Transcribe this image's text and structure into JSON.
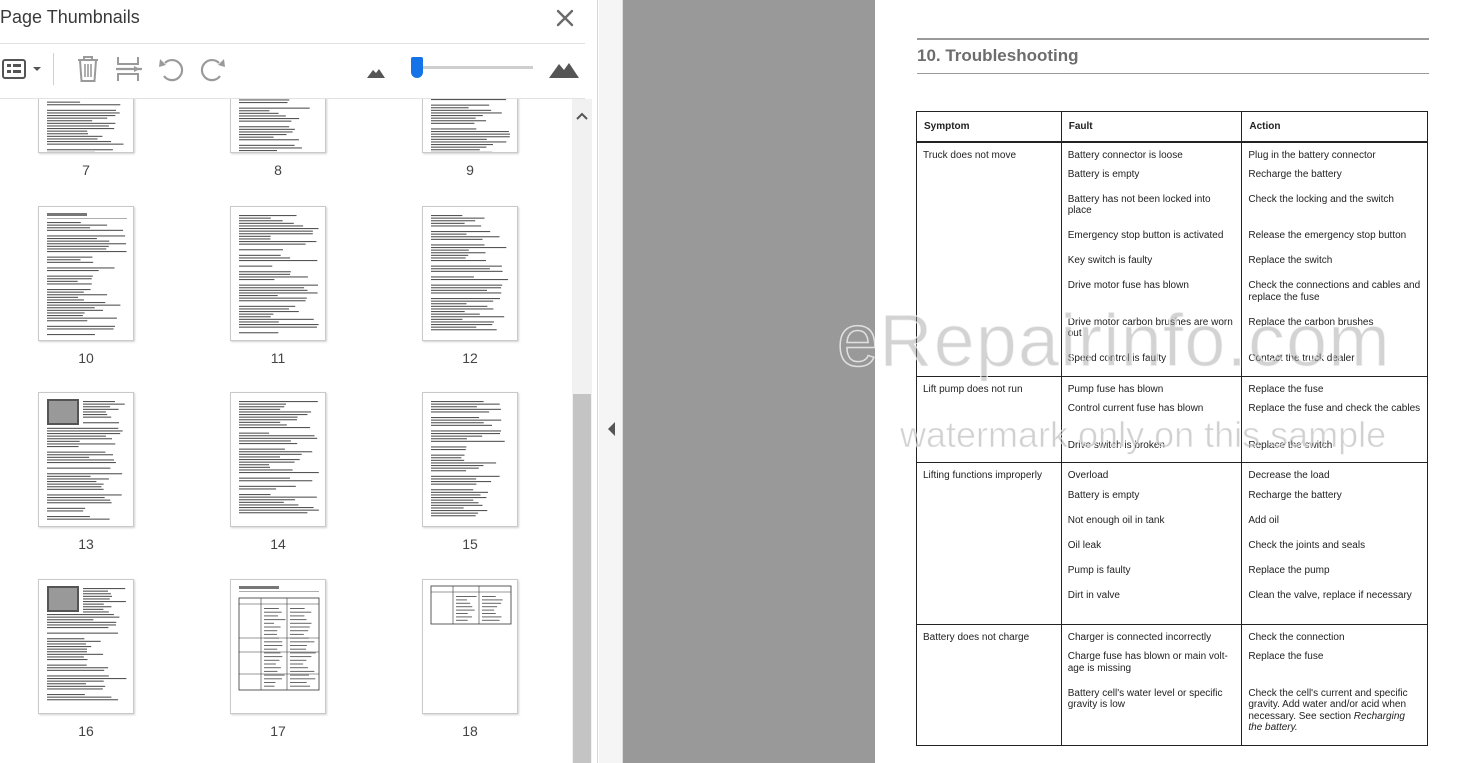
{
  "panel": {
    "title": "Page Thumbnails",
    "close_icon": "close-icon",
    "toolbar": {
      "options_icon": "thumbnail-options-icon",
      "delete_icon": "trash-icon",
      "insert_icon": "insert-page-icon",
      "undo_icon": "rotate-counterclockwise-icon",
      "redo_icon": "rotate-clockwise-icon",
      "zoom_out_icon": "small-mountain-icon",
      "zoom_in_icon": "large-mountain-icon",
      "zoom_level": 0.05
    },
    "accent": "#1473e6",
    "thumbnails": [
      "7",
      "8",
      "9",
      "10",
      "11",
      "12",
      "13",
      "14",
      "15",
      "16",
      "17",
      "18"
    ]
  },
  "document": {
    "heading": "10.  Troubleshooting",
    "table": {
      "headers": [
        "Symptom",
        "Fault",
        "Action"
      ],
      "groups": [
        {
          "symptom": "Truck does not move",
          "rows": [
            [
              "Battery connector is loose",
              "Plug in the battery connector"
            ],
            [
              "Battery is empty",
              "Recharge the battery"
            ],
            [
              "Battery has not been locked into place",
              "Check the locking and the switch"
            ],
            [
              "Emergency stop button is activated",
              "Release the emergency stop button"
            ],
            [
              "Key switch is faulty",
              "Replace the switch"
            ],
            [
              "Drive motor fuse has blown",
              "Check the connections and cables and replace the fuse"
            ],
            [
              "Drive motor carbon brushes are worn out",
              "Replace the carbon brushes"
            ],
            [
              "Speed control is faulty",
              "Contact the truck dealer"
            ]
          ]
        },
        {
          "symptom": "Lift pump does not run",
          "rows": [
            [
              "Pump fuse has blown",
              "Replace the fuse"
            ],
            [
              "Control current fuse has blown",
              "Replace the fuse and check the cables"
            ],
            [
              "Drive switch is broken",
              "Replace the switch"
            ]
          ]
        },
        {
          "symptom": "Lifting functions improperly",
          "rows": [
            [
              "Overload",
              "Decrease the load"
            ],
            [
              "Battery is empty",
              "Recharge the battery"
            ],
            [
              "Not enough oil in tank",
              "Add oil"
            ],
            [
              "Oil leak",
              "Check the joints and seals"
            ],
            [
              "Pump is faulty",
              "Replace the pump"
            ],
            [
              "Dirt in valve",
              "Clean the valve, replace if necessary"
            ]
          ]
        },
        {
          "symptom": "Battery does not charge",
          "rows": [
            [
              "Charger is connected incorrectly",
              "Check the connection"
            ],
            [
              "Charge fuse has blown or main volt-age is missing",
              "Replace the fuse"
            ],
            [
              "Battery cell's water level or specific gravity is low",
              "Check the cell's current and specific gravity. Add water and/or acid when necessary. See section Recharging the battery."
            ]
          ]
        }
      ]
    }
  },
  "watermark": {
    "line1": "eRepairinfo.com",
    "line2": "watermark only on this sample"
  }
}
